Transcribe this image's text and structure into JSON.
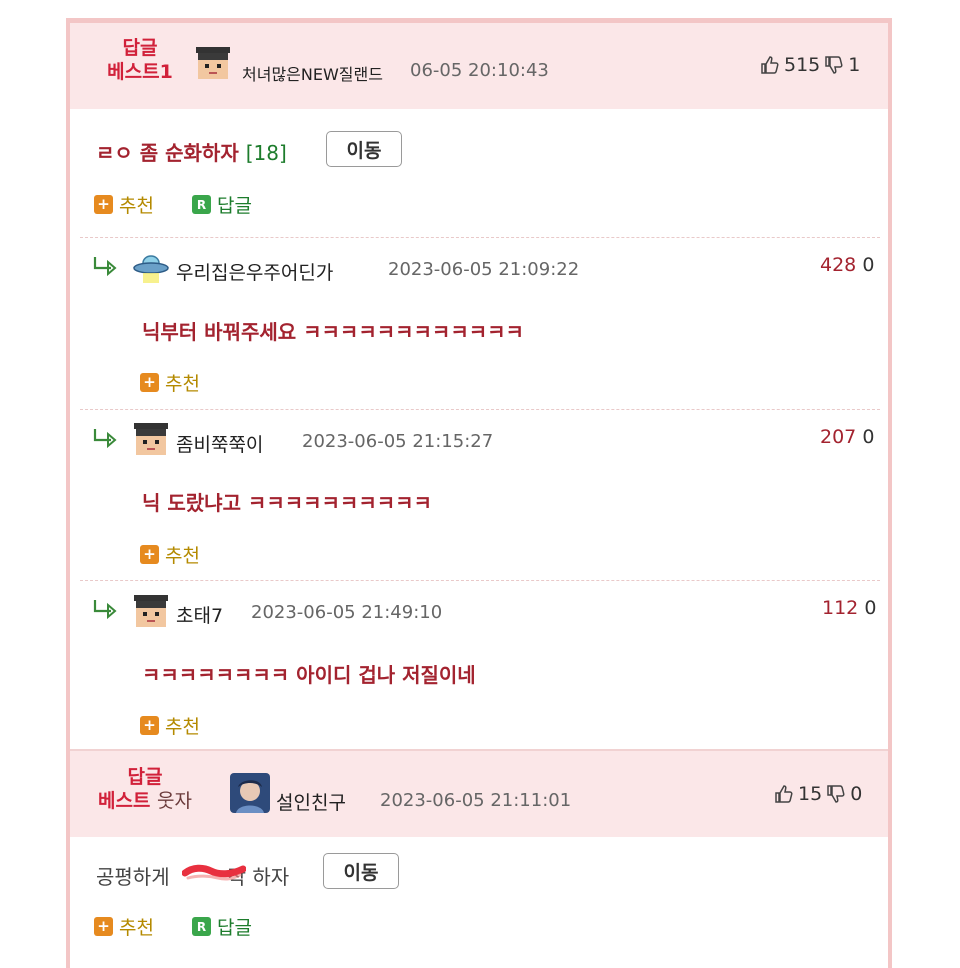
{
  "post1": {
    "badge_top": "답글",
    "badge_bottom": "베스트1",
    "nickname": "처녀많은NEW질랜드",
    "date": "06-05 20:10:43",
    "likes": "515",
    "dislikes": "1",
    "title": "ㄹㅇ 좀 순화하자",
    "comment_count": "[18]",
    "move_label": "이동",
    "recommend_label": "추천",
    "reply_label": "답글"
  },
  "replies": [
    {
      "nickname": "우리집은우주어딘가",
      "date": "2023-06-05 21:09:22",
      "likes": "428",
      "dislikes": "0",
      "text": "닉부터 바꿔주세요 ㅋㅋㅋㅋㅋㅋㅋㅋㅋㅋㅋㅋ",
      "recommend_label": "추천",
      "avatar_icon": "ufo-icon"
    },
    {
      "nickname": "좀비쭉쭉이",
      "date": "2023-06-05 21:15:27",
      "likes": "207",
      "dislikes": "0",
      "text": "닉 도랐냐고 ㅋㅋㅋㅋㅋㅋㅋㅋㅋㅋ",
      "recommend_label": "추천",
      "avatar_icon": "pixel-face-icon"
    },
    {
      "nickname": "초태7",
      "date": "2023-06-05 21:49:10",
      "likes": "112",
      "dislikes": "0",
      "text": "ㅋㅋㅋㅋㅋㅋㅋㅋ 아이디 겁나 저질이네",
      "recommend_label": "추천",
      "avatar_icon": "pixel-face-icon"
    }
  ],
  "post2": {
    "badge_top": "답글",
    "badge_bottom_1": "베스트",
    "badge_bottom_2": "웃자",
    "nickname": "설인친구",
    "date": "2023-06-05 21:11:01",
    "likes": "15",
    "dislikes": "0",
    "title_before": "공평하게",
    "title_after": "작 하자",
    "move_label": "이동",
    "recommend_label": "추천",
    "reply_label": "답글"
  },
  "colors": {
    "badge_red": "#d1213a",
    "comment_red": "#a3232f",
    "header_pink": "#fbe7e8",
    "border_pink": "#f3c6c6",
    "count_green": "#1d7c2c",
    "plus_orange": "#e68a1f"
  }
}
